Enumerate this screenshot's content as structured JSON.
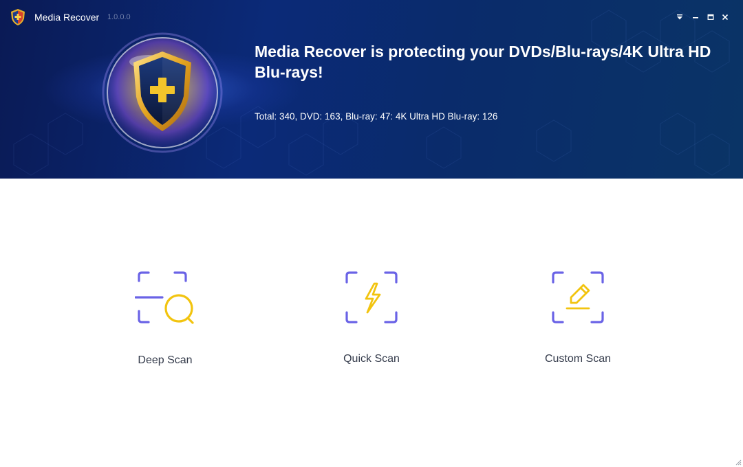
{
  "window": {
    "title": "Media Recover",
    "version": "1.0.0.0",
    "controls": [
      "menu-dropdown-icon",
      "minimize-icon",
      "maximize-icon",
      "close-icon"
    ]
  },
  "header": {
    "headline": "Media Recover is protecting your DVDs/Blu-rays/4K Ultra HD Blu-rays!",
    "stats": "Total: 340, DVD: 163, Blu-ray: 47: 4K Ultra HD Blu-ray: 126"
  },
  "scan_options": [
    {
      "label": "Deep Scan",
      "icon": "deep-scan-icon"
    },
    {
      "label": "Quick Scan",
      "icon": "quick-scan-icon"
    },
    {
      "label": "Custom Scan",
      "icon": "custom-scan-icon"
    }
  ],
  "colors": {
    "header_bg": "#0b2a78",
    "icon_frame": "#6a63e6",
    "icon_accent": "#f2c40f",
    "label_text": "#333a4a",
    "shield_gold": "#e8b22a",
    "shield_body": "#0d1d4a"
  }
}
